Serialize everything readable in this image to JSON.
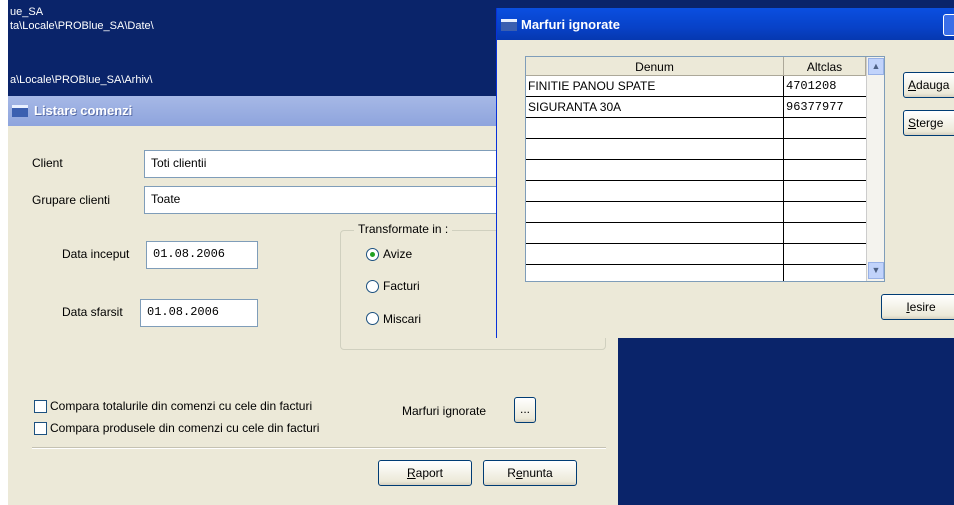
{
  "background": {
    "paths": [
      "ue_SA",
      "ta\\Locale\\PROBlue_SA\\Date\\",
      "a\\Locale\\PROBlue_SA\\Arhiv\\"
    ]
  },
  "listare": {
    "title": "Listare comenzi",
    "client_label": "Client",
    "client_value": "Toti clientii",
    "grupare_label": "Grupare clienti",
    "grupare_value": "Toate",
    "data_inceput_label": "Data inceput",
    "data_inceput_value": "01.08.2006",
    "data_sfarsit_label": "Data sfarsit",
    "data_sfarsit_value": "01.08.2006",
    "transformate_label": "Transformate in :",
    "radios": [
      "Avize",
      "Facturi",
      "Miscari"
    ],
    "selected_radio": "Avize",
    "check_totaluri": "Compara totalurile din comenzi cu cele din facturi",
    "check_produse": "Compara produsele din comenzi cu cele din facturi",
    "marfuri_label": "Marfuri ignorate",
    "marfuri_button": "...",
    "raport_first": "R",
    "raport_rest": "aport",
    "renunta_first": "R",
    "renunta_underline": "e",
    "renunta_rest": "nunta"
  },
  "marfuri": {
    "title": "Marfuri ignorate",
    "columns": [
      "Denum",
      "Altclas"
    ],
    "rows": [
      [
        "FINITIE PANOU SPATE",
        "4701208"
      ],
      [
        "SIGURANTA 30A",
        "96377977"
      ]
    ],
    "adauga_first": "A",
    "adauga_rest": "dauga",
    "sterge_first": "S",
    "sterge_rest": "terge",
    "iesire_first": "I",
    "iesire_rest": "esire"
  },
  "colors": {
    "desktop": "#0a246a",
    "active_title": "#0842c8",
    "inactive_title": "#a6b8e6",
    "dialog_face": "#ece9d8"
  },
  "icons": [
    "app-icon",
    "close-icon",
    "scroll-up-icon",
    "scroll-down-icon"
  ]
}
